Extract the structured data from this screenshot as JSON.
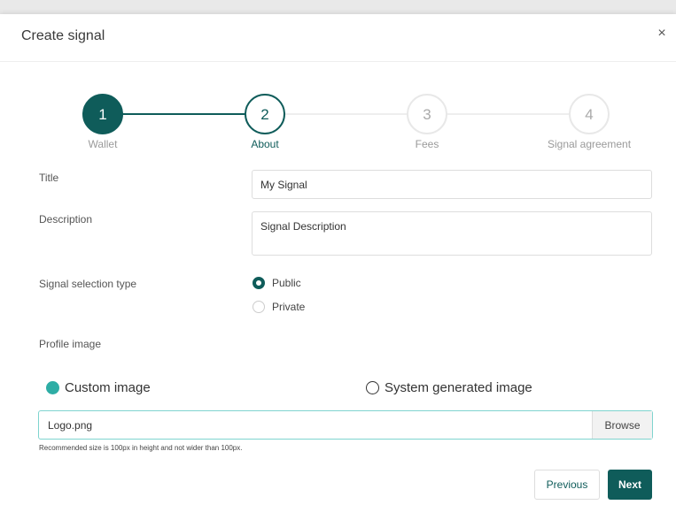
{
  "modal": {
    "title": "Create signal",
    "close": "×"
  },
  "stepper": {
    "steps": [
      {
        "number": "1",
        "label": "Wallet",
        "state": "completed"
      },
      {
        "number": "2",
        "label": "About",
        "state": "active"
      },
      {
        "number": "3",
        "label": "Fees",
        "state": "upcoming"
      },
      {
        "number": "4",
        "label": "Signal agreement",
        "state": "upcoming"
      }
    ],
    "colors": {
      "primary": "#0f5c5a",
      "inactive": "#e8e8e8"
    }
  },
  "form": {
    "title_label": "Title",
    "title_value": "My Signal",
    "description_label": "Description",
    "description_value": "Signal Description",
    "selection_label": "Signal selection type",
    "selection_options": [
      {
        "label": "Public",
        "selected": true
      },
      {
        "label": "Private",
        "selected": false
      }
    ],
    "profile_label": "Profile image",
    "profile_options": [
      {
        "label": "Custom image",
        "selected": true
      },
      {
        "label": "System generated image",
        "selected": false
      }
    ],
    "file_value": "Logo.png",
    "browse_label": "Browse",
    "hint": "Recommended size is 100px in height and not wider than 100px."
  },
  "footer": {
    "previous_label": "Previous",
    "next_label": "Next"
  }
}
